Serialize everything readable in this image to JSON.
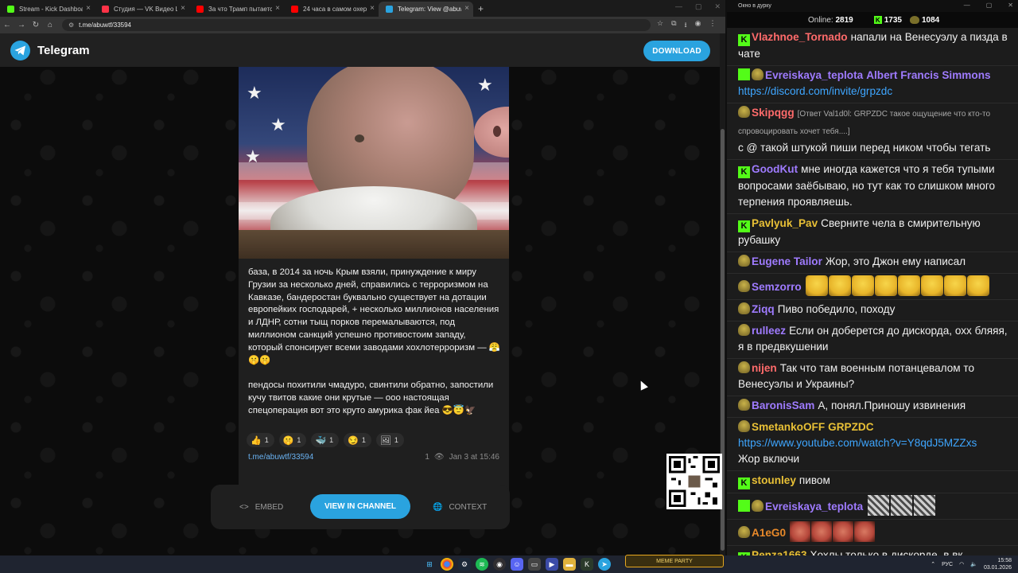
{
  "browser": {
    "tabs": [
      {
        "title": "Stream - Kick Dashboard",
        "color": "#53fc18",
        "active": false
      },
      {
        "title": "Студия — VK Видео Live",
        "color": "#ff3347",
        "active": false
      },
      {
        "title": "За что Трамп пытается убить",
        "color": "#ff0000",
        "active": false
      },
      {
        "title": "24 часа в самом охеревшем",
        "color": "#ff0000",
        "active": false
      },
      {
        "title": "Telegram: View @abuwtf",
        "color": "#2aa3df",
        "active": true
      }
    ],
    "url": "t.me/abuwtf/33594"
  },
  "telegram": {
    "app_name": "Telegram",
    "download_label": "DOWNLOAD",
    "post": {
      "text_p1": "база, в 2014 за ночь Крым взяли, принуждение к миру Грузии за несколько дней, справились с терроризмом на Кавказе, бандеростан буквально существует на дотации европейких господарей, + несколько миллионов населения и ЛДНР, сотни тыщ порков перемалываются, под миллионом санкций успешно противостоим западу, который спонсирует всеми заводами хохлотерроризм — 😤🤫🤫",
      "text_p2": "пендосы похитили чмадуро, свинтили обратно, запостили кучу твитов какие они крутые — ооо настоящая спецоперация вот это круто амурика фак йеа 😎😇🦅",
      "reactions": [
        {
          "emoji": "👍",
          "count": "1"
        },
        {
          "emoji": "🤫",
          "count": "1"
        },
        {
          "emoji": "🐳",
          "count": "1"
        },
        {
          "emoji": "😏",
          "count": "1"
        },
        {
          "emoji": "🖼",
          "count": "1"
        }
      ],
      "link": "t.me/abuwtf/33594",
      "views": "1",
      "date": "Jan 3 at 15:46"
    },
    "actions": {
      "embed": "EMBED",
      "view_in_channel": "VIEW IN CHANNEL",
      "context": "CONTEXT"
    }
  },
  "chat": {
    "window_title": "Окно в дурку",
    "online_label": "Online:",
    "online_count": "2819",
    "kick_count": "1735",
    "vip_count": "1084",
    "messages": [
      {
        "badges": [
          "k"
        ],
        "user": "Vlazhnoe_Tornado",
        "color": "#ff6b6b",
        "text": "напали на Венесуэлу а пизда в чате"
      },
      {
        "badges": [
          "t",
          "e"
        ],
        "user": "Evreiskaya_teplota",
        "color": "#9f7bff",
        "text": "Albert Francis Simmons",
        "text_color": "#9f7bff",
        "link": "https://discord.com/invite/grpzdc"
      },
      {
        "badges": [
          "e"
        ],
        "user": "Skipqgg",
        "color": "#ff6b6b",
        "reply": "[Ответ Val1d0l: GRPZDC такое ощущение что кто-то спровоцировать хочет тебя....]",
        "text": "с @ такой штукой пиши перед ником чтобы тегать"
      },
      {
        "badges": [
          "k"
        ],
        "user": "GoodKut",
        "color": "#9f7bff",
        "text": "мне иногда кажется что я тебя тупыми вопросами заёбываю, но тут как то слишком много терпения проявляешь."
      },
      {
        "badges": [
          "k"
        ],
        "user": "Pavlyuk_Pav",
        "color": "#e8c036",
        "text": "Сверните чела в смирительную рубашку"
      },
      {
        "badges": [
          "e"
        ],
        "user": "Eugene Tailor",
        "color": "#9f7bff",
        "text": "Жор, это Джон ему написал"
      },
      {
        "badges": [
          "e"
        ],
        "user": "Semzorro",
        "color": "#9f7bff",
        "emotes": 8,
        "emote_type": "laugh"
      },
      {
        "badges": [
          "e"
        ],
        "user": "Ziqq",
        "color": "#9f7bff",
        "text": "Пиво победило, походу"
      },
      {
        "badges": [
          "e"
        ],
        "user": "rulleez",
        "color": "#9f7bff",
        "text": "Если он доберется до дискорда, охх бляяя, я в предвкушении"
      },
      {
        "badges": [
          "e"
        ],
        "user": "nijen",
        "color": "#ff6b6b",
        "text": "Так что там военным потанцевалом то Венесуэлы и Украины?"
      },
      {
        "badges": [
          "e"
        ],
        "user": "BaronisSam",
        "color": "#9f7bff",
        "text": "А, понял.Приношу извинения"
      },
      {
        "badges": [
          "e"
        ],
        "user": "SmetankoOFF",
        "color": "#e8c036",
        "text": "GRPZDC",
        "text_color": "#e8c036",
        "link": "https://www.youtube.com/watch?v=Y8qdJ5MZZxs",
        "text2": "Жор включи"
      },
      {
        "badges": [
          "k"
        ],
        "user": "stounley",
        "color": "#e8c036",
        "text": "пивом"
      },
      {
        "badges": [
          "t",
          "e"
        ],
        "user": "Evreiskaya_teplota",
        "color": "#9f7bff",
        "emotes": 3,
        "emote_type": "static"
      },
      {
        "badges": [
          "e"
        ],
        "user": "A1eG0",
        "color": "#e8892a",
        "emotes": 4,
        "emote_type": "face"
      },
      {
        "badges": [
          "k"
        ],
        "user": "Penza1663",
        "color": "#e8c036",
        "text": "Хохлы только в дискорде, в вк"
      }
    ]
  },
  "taskbar": {
    "panel_label": "MEME PARTY",
    "lang": "РУС",
    "time": "15:58",
    "date": "03.01.2026"
  }
}
